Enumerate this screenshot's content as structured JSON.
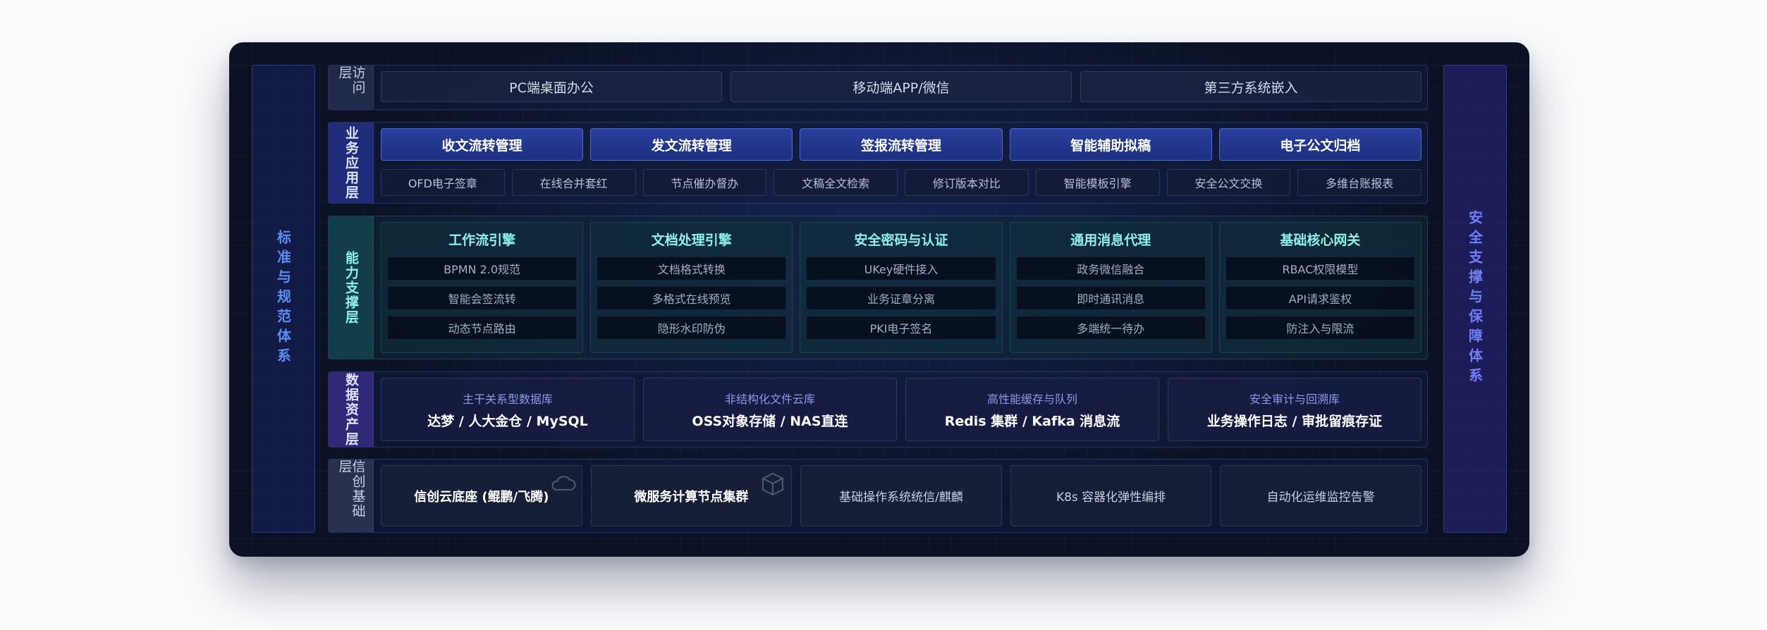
{
  "left_pillar": {
    "label": "标准与规范体系"
  },
  "right_pillar": {
    "label": "安全支撑与保障体系"
  },
  "access_layer": {
    "label": "访问层",
    "items": [
      "PC端桌面办公",
      "移动端APP/微信",
      "第三方系统嵌入"
    ]
  },
  "business_layer": {
    "label": "业务应用层",
    "primary": [
      "收文流转管理",
      "发文流转管理",
      "签报流转管理",
      "智能辅助拟稿",
      "电子公文归档"
    ],
    "secondary": [
      "OFD电子签章",
      "在线合并套红",
      "节点催办督办",
      "文稿全文检索",
      "修订版本对比",
      "智能模板引擎",
      "安全公文交换",
      "多维台账报表"
    ]
  },
  "capability_layer": {
    "label": "能力支撑层",
    "columns": [
      {
        "title": "工作流引擎",
        "items": [
          "BPMN 2.0规范",
          "智能会签流转",
          "动态节点路由"
        ]
      },
      {
        "title": "文档处理引擎",
        "items": [
          "文档格式转换",
          "多格式在线预览",
          "隐形水印防伪"
        ]
      },
      {
        "title": "安全密码与认证",
        "items": [
          "UKey硬件接入",
          "业务证章分离",
          "PKI电子签名"
        ]
      },
      {
        "title": "通用消息代理",
        "items": [
          "政务微信融合",
          "即时通讯消息",
          "多端统一待办"
        ]
      },
      {
        "title": "基础核心网关",
        "items": [
          "RBAC权限模型",
          "API请求鉴权",
          "防注入与限流"
        ]
      }
    ]
  },
  "data_layer": {
    "label": "数据资产层",
    "items": [
      {
        "caption": "主干关系型数据库",
        "value": "达梦 / 人大金仓 / MySQL"
      },
      {
        "caption": "非结构化文件云库",
        "value": "OSS对象存储 / NAS直连"
      },
      {
        "caption": "高性能缓存与队列",
        "value": "Redis 集群 / Kafka 消息流"
      },
      {
        "caption": "安全审计与回溯库",
        "value": "业务操作日志 / 审批留痕存证"
      }
    ]
  },
  "infra_layer": {
    "label": "信创基础层",
    "items": [
      "信创云底座 (鲲鹏/飞腾)",
      "微服务计算节点集群",
      "基础操作系统统信/麒麟",
      "K8s 容器化弹性编排",
      "自动化运维监控告警"
    ]
  },
  "icons": {
    "cloud": "cloud-icon",
    "cube": "cube-icon"
  }
}
